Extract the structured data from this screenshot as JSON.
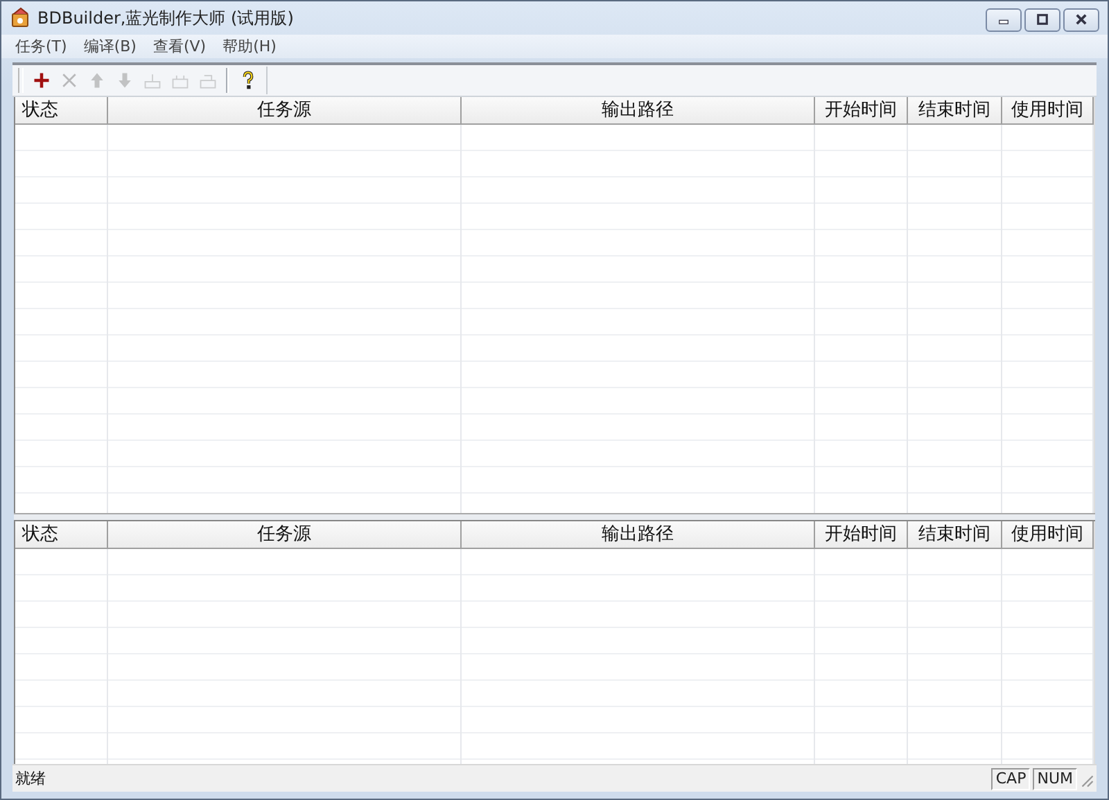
{
  "window": {
    "title": "BDBuilder,蓝光制作大师 (试用版)"
  },
  "menu": [
    "任务(T)",
    "编译(B)",
    "查看(V)",
    "帮助(H)"
  ],
  "toolbar": [
    {
      "kind": "add",
      "disabled": false
    },
    {
      "kind": "delete",
      "disabled": true
    },
    {
      "kind": "up",
      "disabled": true
    },
    {
      "kind": "down",
      "disabled": true
    },
    {
      "kind": "tray",
      "disabled": true
    },
    {
      "kind": "tray2",
      "disabled": true
    },
    {
      "kind": "tray3",
      "disabled": true
    },
    {
      "kind": "separator"
    },
    {
      "kind": "help",
      "disabled": false
    }
  ],
  "tables": [
    {
      "columns": [
        "状态",
        "任务源",
        "输出路径",
        "开始时间",
        "结束时间",
        "使用时间"
      ]
    },
    {
      "columns": [
        "状态",
        "任务源",
        "输出路径",
        "开始时间",
        "结束时间",
        "使用时间"
      ]
    }
  ],
  "status_bar": {
    "text": "就绪",
    "indicators": [
      "CAP",
      "NUM"
    ]
  }
}
